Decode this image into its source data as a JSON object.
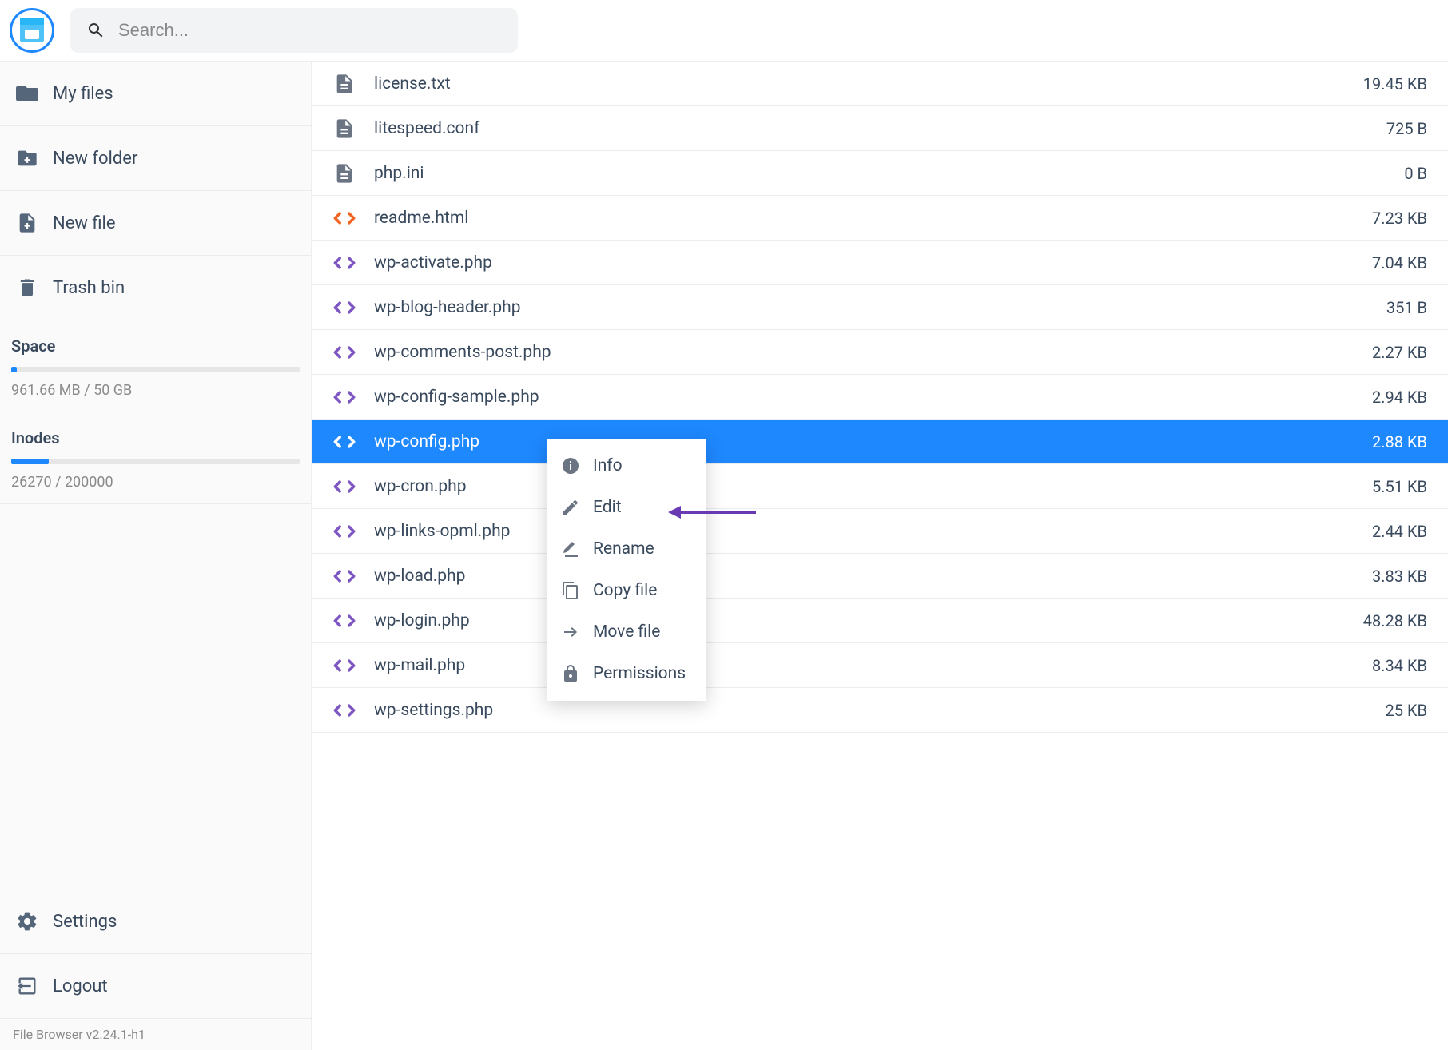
{
  "header": {
    "search_placeholder": "Search..."
  },
  "sidebar": {
    "items": [
      {
        "id": "my-files",
        "label": "My files",
        "icon": "folder"
      },
      {
        "id": "new-folder",
        "label": "New folder",
        "icon": "folder-plus"
      },
      {
        "id": "new-file",
        "label": "New file",
        "icon": "note-add"
      },
      {
        "id": "trash-bin",
        "label": "Trash bin",
        "icon": "trash"
      }
    ],
    "space": {
      "title": "Space",
      "used": "961.66 MB",
      "total": "50 GB",
      "text": "961.66 MB / 50 GB",
      "pct": 2
    },
    "inodes": {
      "title": "Inodes",
      "used": "26270",
      "total": "200000",
      "text": "26270 / 200000",
      "pct": 13
    },
    "bottom": [
      {
        "id": "settings",
        "label": "Settings",
        "icon": "settings"
      },
      {
        "id": "logout",
        "label": "Logout",
        "icon": "logout"
      }
    ],
    "version": "File Browser v2.24.1-h1"
  },
  "files": [
    {
      "name": "license.txt",
      "size": "19.45 KB",
      "icon": "doc",
      "selected": false
    },
    {
      "name": "litespeed.conf",
      "size": "725 B",
      "icon": "doc",
      "selected": false
    },
    {
      "name": "php.ini",
      "size": "0 B",
      "icon": "doc",
      "selected": false
    },
    {
      "name": "readme.html",
      "size": "7.23 KB",
      "icon": "html",
      "selected": false
    },
    {
      "name": "wp-activate.php",
      "size": "7.04 KB",
      "icon": "code",
      "selected": false
    },
    {
      "name": "wp-blog-header.php",
      "size": "351 B",
      "icon": "code",
      "selected": false
    },
    {
      "name": "wp-comments-post.php",
      "size": "2.27 KB",
      "icon": "code",
      "selected": false
    },
    {
      "name": "wp-config-sample.php",
      "size": "2.94 KB",
      "icon": "code",
      "selected": false
    },
    {
      "name": "wp-config.php",
      "size": "2.88 KB",
      "icon": "code",
      "selected": true
    },
    {
      "name": "wp-cron.php",
      "size": "5.51 KB",
      "icon": "code",
      "selected": false
    },
    {
      "name": "wp-links-opml.php",
      "size": "2.44 KB",
      "icon": "code",
      "selected": false
    },
    {
      "name": "wp-load.php",
      "size": "3.83 KB",
      "icon": "code",
      "selected": false
    },
    {
      "name": "wp-login.php",
      "size": "48.28 KB",
      "icon": "code",
      "selected": false
    },
    {
      "name": "wp-mail.php",
      "size": "8.34 KB",
      "icon": "code",
      "selected": false
    },
    {
      "name": "wp-settings.php",
      "size": "25 KB",
      "icon": "code",
      "selected": false
    }
  ],
  "context_menu": {
    "items": [
      {
        "id": "info",
        "label": "Info",
        "icon": "info"
      },
      {
        "id": "edit",
        "label": "Edit",
        "icon": "edit"
      },
      {
        "id": "rename",
        "label": "Rename",
        "icon": "rename"
      },
      {
        "id": "copy",
        "label": "Copy file",
        "icon": "copy"
      },
      {
        "id": "move",
        "label": "Move file",
        "icon": "move"
      },
      {
        "id": "perms",
        "label": "Permissions",
        "icon": "lock"
      }
    ]
  }
}
